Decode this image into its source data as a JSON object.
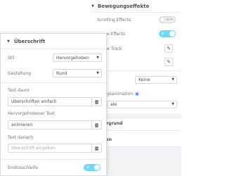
{
  "background": {
    "section_title": "Bewegungseffekte",
    "scrolling_effects_label": "Scrolling Effects",
    "scrolling_toggle_label": "NEIN",
    "mouse_effects_label": "e Effects",
    "mouse_toggle_label": "JA",
    "mouse_track_label": "e Track",
    "entrance_select_value": "Keine",
    "entrance_label": "gsanimation",
    "speed_select_value": "ale",
    "background_section_title": "ntergrund",
    "border_section_title": "hmen",
    "colors": {
      "accent": "#71d7f7",
      "monitor_icon": "#4285f4"
    }
  },
  "popover": {
    "title": "Überschrift",
    "style_label": "Stil",
    "style_value": "Hervorgehoben",
    "shape_label": "Gestaltung",
    "shape_value": "Rund",
    "before_label": "Text davor",
    "before_value": "Überschriften einfach",
    "highlighted_label": "Hervorgehobener Text",
    "highlighted_value": "animieren",
    "after_label": "Text danach",
    "after_placeholder": "Überschrift eingeben",
    "loop_label": "Endlosschleife",
    "loop_toggle_label": "JA"
  }
}
